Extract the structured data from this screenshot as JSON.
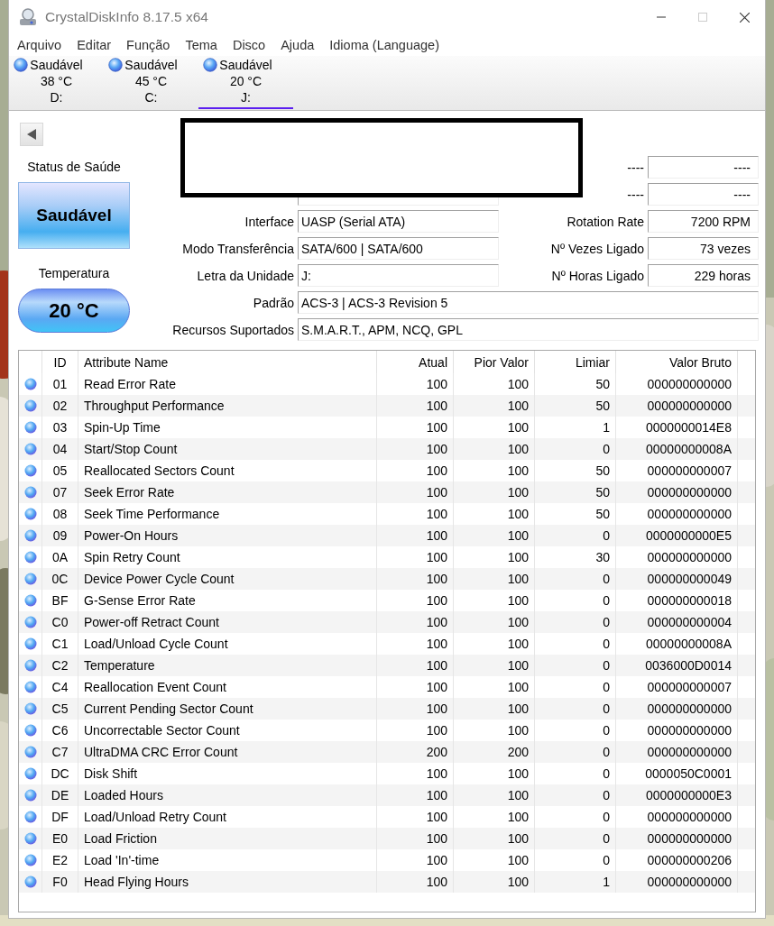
{
  "window": {
    "title": "CrystalDiskInfo 8.17.5 x64"
  },
  "menu": [
    "Arquivo",
    "Editar",
    "Função",
    "Tema",
    "Disco",
    "Ajuda",
    "Idioma (Language)"
  ],
  "drives": [
    {
      "status": "Saudável",
      "temperature": "38 °C",
      "letter": "D:",
      "selected": false
    },
    {
      "status": "Saudável",
      "temperature": "45 °C",
      "letter": "C:",
      "selected": false
    },
    {
      "status": "Saudável",
      "temperature": "20 °C",
      "letter": "J:",
      "selected": true
    }
  ],
  "health": {
    "label": "Status de Saúde",
    "status": "Saudável"
  },
  "temperature": {
    "label": "Temperatura",
    "value": "20 °C"
  },
  "details": [
    {
      "kind": "pair",
      "right": {
        "label": "----",
        "value": "----"
      }
    },
    {
      "kind": "pair",
      "right": {
        "label": "----",
        "value": "----"
      }
    },
    {
      "kind": "pair",
      "left": {
        "label": "Interface",
        "value": "UASP (Serial ATA)"
      },
      "right": {
        "label": "Rotation Rate",
        "value": "7200 RPM"
      }
    },
    {
      "kind": "pair",
      "left": {
        "label": "Modo Transferência",
        "value": "SATA/600 | SATA/600"
      },
      "right": {
        "label": "Nº Vezes Ligado",
        "value": "73 vezes"
      }
    },
    {
      "kind": "pair",
      "left": {
        "label": "Letra da Unidade",
        "value": "J:"
      },
      "right": {
        "label": "Nº Horas Ligado",
        "value": "229 horas"
      }
    },
    {
      "kind": "wide",
      "left": {
        "label": "Padrão",
        "value": "ACS-3 | ACS-3 Revision 5"
      }
    },
    {
      "kind": "wide",
      "left": {
        "label": "Recursos Suportados",
        "value": "S.M.A.R.T., APM, NCQ, GPL"
      }
    }
  ],
  "table": {
    "columns": [
      "ID",
      "Attribute Name",
      "Atual",
      "Pior Valor",
      "Limiar",
      "Valor Bruto"
    ],
    "rows": [
      {
        "id": "01",
        "name": "Read Error Rate",
        "current": "100",
        "worst": "100",
        "threshold": "50",
        "raw": "000000000000"
      },
      {
        "id": "02",
        "name": "Throughput Performance",
        "current": "100",
        "worst": "100",
        "threshold": "50",
        "raw": "000000000000"
      },
      {
        "id": "03",
        "name": "Spin-Up Time",
        "current": "100",
        "worst": "100",
        "threshold": "1",
        "raw": "0000000014E8"
      },
      {
        "id": "04",
        "name": "Start/Stop Count",
        "current": "100",
        "worst": "100",
        "threshold": "0",
        "raw": "00000000008A"
      },
      {
        "id": "05",
        "name": "Reallocated Sectors Count",
        "current": "100",
        "worst": "100",
        "threshold": "50",
        "raw": "000000000007"
      },
      {
        "id": "07",
        "name": "Seek Error Rate",
        "current": "100",
        "worst": "100",
        "threshold": "50",
        "raw": "000000000000"
      },
      {
        "id": "08",
        "name": "Seek Time Performance",
        "current": "100",
        "worst": "100",
        "threshold": "50",
        "raw": "000000000000"
      },
      {
        "id": "09",
        "name": "Power-On Hours",
        "current": "100",
        "worst": "100",
        "threshold": "0",
        "raw": "0000000000E5"
      },
      {
        "id": "0A",
        "name": "Spin Retry Count",
        "current": "100",
        "worst": "100",
        "threshold": "30",
        "raw": "000000000000"
      },
      {
        "id": "0C",
        "name": "Device Power Cycle Count",
        "current": "100",
        "worst": "100",
        "threshold": "0",
        "raw": "000000000049"
      },
      {
        "id": "BF",
        "name": "G-Sense Error Rate",
        "current": "100",
        "worst": "100",
        "threshold": "0",
        "raw": "000000000018"
      },
      {
        "id": "C0",
        "name": "Power-off Retract Count",
        "current": "100",
        "worst": "100",
        "threshold": "0",
        "raw": "000000000004"
      },
      {
        "id": "C1",
        "name": "Load/Unload Cycle Count",
        "current": "100",
        "worst": "100",
        "threshold": "0",
        "raw": "00000000008A"
      },
      {
        "id": "C2",
        "name": "Temperature",
        "current": "100",
        "worst": "100",
        "threshold": "0",
        "raw": "0036000D0014"
      },
      {
        "id": "C4",
        "name": "Reallocation Event Count",
        "current": "100",
        "worst": "100",
        "threshold": "0",
        "raw": "000000000007"
      },
      {
        "id": "C5",
        "name": "Current Pending Sector Count",
        "current": "100",
        "worst": "100",
        "threshold": "0",
        "raw": "000000000000"
      },
      {
        "id": "C6",
        "name": "Uncorrectable Sector Count",
        "current": "100",
        "worst": "100",
        "threshold": "0",
        "raw": "000000000000"
      },
      {
        "id": "C7",
        "name": "UltraDMA CRC Error Count",
        "current": "200",
        "worst": "200",
        "threshold": "0",
        "raw": "000000000000"
      },
      {
        "id": "DC",
        "name": "Disk Shift",
        "current": "100",
        "worst": "100",
        "threshold": "0",
        "raw": "0000050C0001"
      },
      {
        "id": "DE",
        "name": "Loaded Hours",
        "current": "100",
        "worst": "100",
        "threshold": "0",
        "raw": "0000000000E3"
      },
      {
        "id": "DF",
        "name": "Load/Unload Retry Count",
        "current": "100",
        "worst": "100",
        "threshold": "0",
        "raw": "000000000000"
      },
      {
        "id": "E0",
        "name": "Load Friction",
        "current": "100",
        "worst": "100",
        "threshold": "0",
        "raw": "000000000000"
      },
      {
        "id": "E2",
        "name": "Load 'In'-time",
        "current": "100",
        "worst": "100",
        "threshold": "0",
        "raw": "000000000206"
      },
      {
        "id": "F0",
        "name": "Head Flying Hours",
        "current": "100",
        "worst": "100",
        "threshold": "1",
        "raw": "000000000000"
      }
    ]
  }
}
